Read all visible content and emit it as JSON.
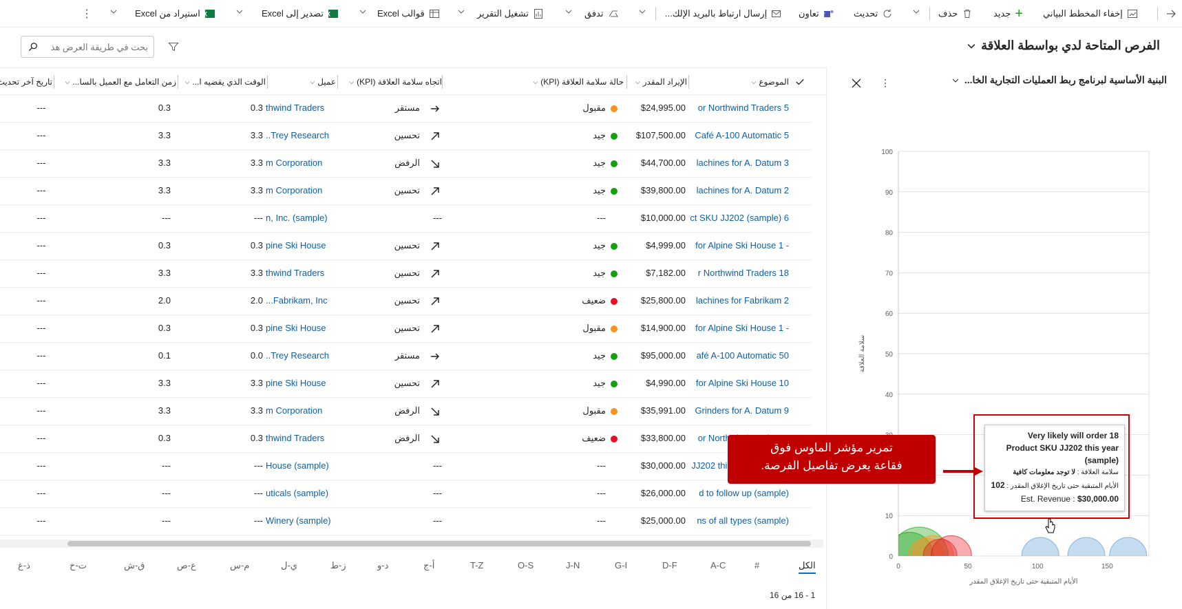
{
  "toolbar": {
    "back": "back",
    "hide_chart": "إخفاء المخطط البياني",
    "new": "جديد",
    "delete": "حذف",
    "refresh": "تحديث",
    "collaborate": "تعاون",
    "email_link": "إرسال ارتباط بالبريد الإلك...",
    "flow": "تدفق",
    "run_report": "تشغيل التقرير",
    "excel_templates": "قوالب Excel",
    "export_excel": "تصدير إلى Excel",
    "import_excel": "استيراد من Excel"
  },
  "view": {
    "title": "الفرص المتاحة لدي بواسطة العلاقة",
    "search_placeholder": "بحث في طريقة العرض هذ"
  },
  "columns": [
    "الموضوع",
    "الإيراد المقدر",
    "حالة سلامة العلاقة (KPI)",
    "اتجاه سلامة العلاقة (KPI)",
    "عميل",
    "الوقت الذي يقضيه ا...",
    "زمن التعامل مع العميل بالسا...",
    "تاريخ آخر تحديث"
  ],
  "rows": [
    {
      "topic": "or Northwind Traders 5",
      "revenue": "$24,995.00",
      "health": "مقبول",
      "health_color": "#f7941d",
      "trend": "مستقر",
      "trend_icon": "arrow-right",
      "account": "thwind Traders",
      "time_spent": "0.3",
      "engage": "0.3",
      "updated": "---"
    },
    {
      "topic": "Café A-100 Automatic 5",
      "revenue": "$107,500.00",
      "health": "جيد",
      "health_color": "#13a10e",
      "trend": "تحسين",
      "trend_icon": "arrow-up-right",
      "account": "..Trey Research",
      "time_spent": "3.3",
      "engage": "3.3",
      "updated": "---"
    },
    {
      "topic": "lachines for A. Datum 3",
      "revenue": "$44,700.00",
      "health": "جيد",
      "health_color": "#13a10e",
      "trend": "الرفض",
      "trend_icon": "arrow-down-right",
      "account": "m Corporation",
      "time_spent": "3.3",
      "engage": "3.3",
      "updated": "---"
    },
    {
      "topic": "lachines for A. Datum 2",
      "revenue": "$39,800.00",
      "health": "جيد",
      "health_color": "#13a10e",
      "trend": "تحسين",
      "trend_icon": "arrow-up-right",
      "account": "m Corporation",
      "time_spent": "3.3",
      "engage": "3.3",
      "updated": "---"
    },
    {
      "topic": "ct SKU JJ202 (sample) 6",
      "revenue": "$10,000.00",
      "health": "---",
      "health_color": "",
      "trend": "---",
      "trend_icon": "",
      "account": "n, Inc. (sample)",
      "time_spent": "---",
      "engage": "---",
      "updated": "---"
    },
    {
      "topic": "for Alpine Ski House 1 -",
      "revenue": "$4,999.00",
      "health": "جيد",
      "health_color": "#13a10e",
      "trend": "تحسين",
      "trend_icon": "arrow-up-right",
      "account": "pine Ski House",
      "time_spent": "0.3",
      "engage": "0.3",
      "updated": "---"
    },
    {
      "topic": "r Northwind Traders 18",
      "revenue": "$7,182.00",
      "health": "جيد",
      "health_color": "#13a10e",
      "trend": "تحسين",
      "trend_icon": "arrow-up-right",
      "account": "thwind Traders",
      "time_spent": "3.3",
      "engage": "3.3",
      "updated": "---"
    },
    {
      "topic": "lachines for Fabrikam 2",
      "revenue": "$25,800.00",
      "health": "ضعيف",
      "health_color": "#e81123",
      "trend": "تحسين",
      "trend_icon": "arrow-up-right",
      "account": "...Fabrikam, Inc",
      "time_spent": "2.0",
      "engage": "2.0",
      "updated": "---"
    },
    {
      "topic": "for Alpine Ski House 1 -",
      "revenue": "$14,900.00",
      "health": "مقبول",
      "health_color": "#f7941d",
      "trend": "تحسين",
      "trend_icon": "arrow-up-right",
      "account": "pine Ski House",
      "time_spent": "0.3",
      "engage": "0.3",
      "updated": "---"
    },
    {
      "topic": "afé A-100 Automatic 50",
      "revenue": "$95,000.00",
      "health": "جيد",
      "health_color": "#13a10e",
      "trend": "مستقر",
      "trend_icon": "arrow-right",
      "account": "..Trey Research",
      "time_spent": "0.0",
      "engage": "0.1",
      "updated": "---"
    },
    {
      "topic": "for Alpine Ski House 10",
      "revenue": "$4,990.00",
      "health": "جيد",
      "health_color": "#13a10e",
      "trend": "تحسين",
      "trend_icon": "arrow-up-right",
      "account": "pine Ski House",
      "time_spent": "3.3",
      "engage": "3.3",
      "updated": "---"
    },
    {
      "topic": "Grinders for A. Datum 9",
      "revenue": "$35,991.00",
      "health": "مقبول",
      "health_color": "#f7941d",
      "trend": "الرفض",
      "trend_icon": "arrow-down-right",
      "account": "m Corporation",
      "time_spent": "3.3",
      "engage": "3.3",
      "updated": "---"
    },
    {
      "topic": "or Northwind Traders 4",
      "revenue": "$33,800.00",
      "health": "ضعيف",
      "health_color": "#e81123",
      "trend": "الرفض",
      "trend_icon": "arrow-down-right",
      "account": "thwind Traders",
      "time_spent": "0.3",
      "engage": "0.3",
      "updated": "---"
    },
    {
      "topic": "JJ202 this year (sample)",
      "revenue": "$30,000.00",
      "health": "---",
      "health_color": "",
      "trend": "---",
      "trend_icon": "",
      "account": "House (sample)",
      "time_spent": "---",
      "engage": "---",
      "updated": "---"
    },
    {
      "topic": "d to follow up (sample)",
      "revenue": "$26,000.00",
      "health": "---",
      "health_color": "",
      "trend": "---",
      "trend_icon": "",
      "account": "uticals (sample)",
      "time_spent": "---",
      "engage": "---",
      "updated": "---"
    },
    {
      "topic": "ns of all types (sample)",
      "revenue": "$25,000.00",
      "health": "---",
      "health_color": "",
      "trend": "---",
      "trend_icon": "",
      "account": "Winery (sample)",
      "time_spent": "---",
      "engage": "---",
      "updated": "---"
    }
  ],
  "alphabet": [
    "الكل",
    "#",
    "A-C",
    "D-F",
    "G-I",
    "J-N",
    "O-S",
    "T-Z",
    "أ-ج",
    "د-و",
    "ز-ط",
    "ي-ل",
    "م-س",
    "ع-ص",
    "ق-ش",
    "ت-خ",
    "ذ-غ"
  ],
  "footer": {
    "count": "1 - 16 من 16"
  },
  "panel": {
    "title": "البنية الأساسية لبرنامج ربط العمليات التجارية الخا..."
  },
  "chart_data": {
    "type": "scatter",
    "title": "",
    "xlabel": "الأيام المتبقية حتى تاريخ الإغلاق المقدر",
    "ylabel": "سلامة العلاقة",
    "xlim": [
      0,
      180
    ],
    "ylim": [
      0,
      100
    ],
    "xticks": [
      0,
      50,
      100,
      150
    ],
    "yticks": [
      0,
      10,
      20,
      30,
      40,
      50,
      60,
      70,
      80,
      90,
      100
    ],
    "grid": true,
    "bubbles": [
      {
        "x": 15,
        "y": 0,
        "size": 60,
        "color": "#13a10e"
      },
      {
        "x": 8,
        "y": 0,
        "size": 45,
        "color": "#13a10e"
      },
      {
        "x": 25,
        "y": 0,
        "size": 35,
        "color": "#f7941d"
      },
      {
        "x": 20,
        "y": 0,
        "size": 28,
        "color": "#f7941d"
      },
      {
        "x": 38,
        "y": 0,
        "size": 35,
        "color": "#e81123"
      },
      {
        "x": 30,
        "y": 0,
        "size": 25,
        "color": "#e81123"
      },
      {
        "x": 102,
        "y": 0,
        "size": 30,
        "color": "#5b9bd5"
      },
      {
        "x": 135,
        "y": 0,
        "size": 30,
        "color": "#5b9bd5"
      },
      {
        "x": 165,
        "y": 0,
        "size": 30,
        "color": "#5b9bd5"
      }
    ]
  },
  "tooltip": {
    "title_line1": "Very likely will order 18",
    "title_line2": "Product SKU JJ202 this year",
    "title_line3": "(sample)",
    "health_label": "سلامة العلاقة :",
    "health_value": "لا توجد معلومات كافية",
    "days_label": "الأيام المتبقية حتى تاريخ الإغلاق المقدر :",
    "days_value": "102",
    "rev_label": "Est. Revenue :",
    "rev_value": "$30,000.00"
  },
  "callout": {
    "line1": "تمرير مؤشر الماوس فوق",
    "line2": "فقاعة يعرض تفاصيل الفرصة."
  }
}
